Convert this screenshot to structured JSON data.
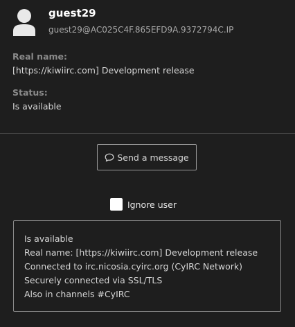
{
  "user": {
    "nick": "guest29",
    "mask": "guest29@AC025C4F.865EFD9A.9372794C.IP"
  },
  "profile": {
    "realname_label": "Real name:",
    "realname_value": "[https://kiwiirc.com] Development release",
    "status_label": "Status:",
    "status_value": "Is available"
  },
  "actions": {
    "send_message_label": "Send a message",
    "ignore_label": "Ignore user",
    "ignore_checked": false
  },
  "whois": {
    "lines": [
      "Is available",
      "Real name: [https://kiwiirc.com] Development release",
      "Connected to irc.nicosia.cyirc.org (CyIRC Network)",
      "Securely connected via SSL/TLS",
      "Also in channels #CyIRC"
    ]
  },
  "icons": {
    "avatar": "user-avatar-icon",
    "message": "speech-bubble-icon"
  },
  "colors": {
    "background": "#1e1e1e",
    "text": "#d6d6d6",
    "label": "#8a8a8a",
    "nick": "#ffffff",
    "mask": "#a8a8a8",
    "border": "#8a8a8a"
  }
}
